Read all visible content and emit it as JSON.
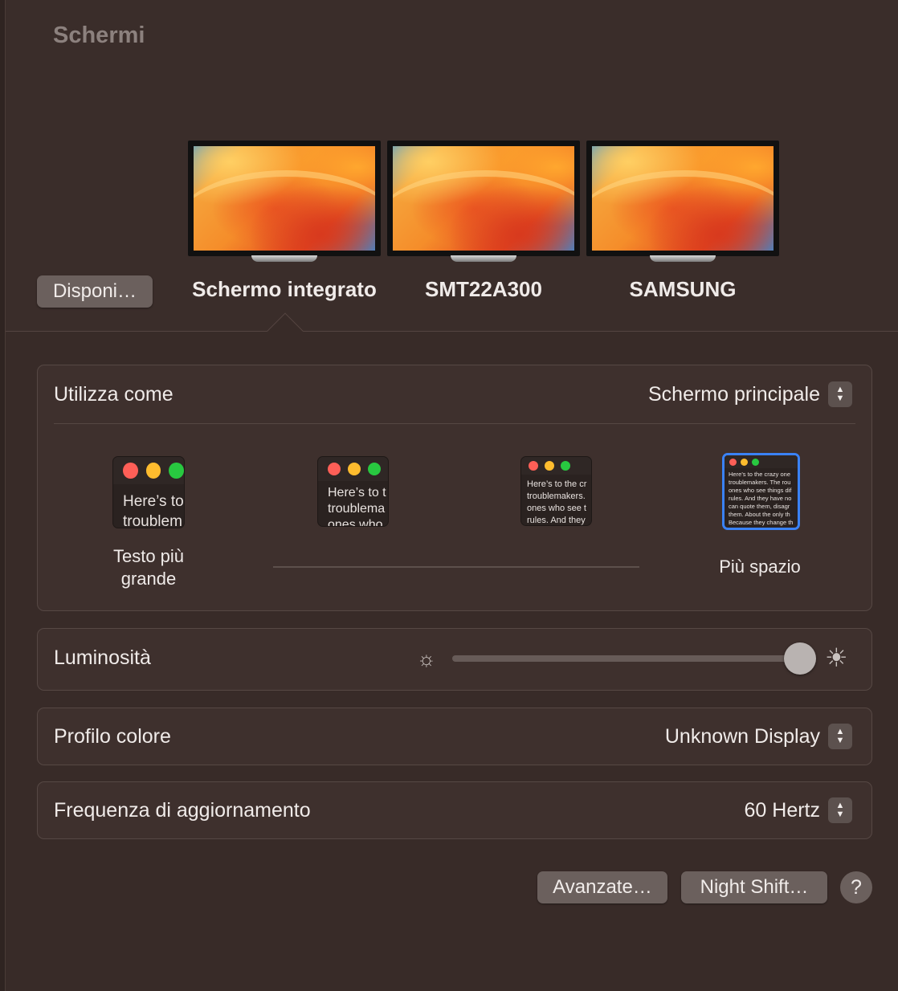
{
  "window": {
    "title": "Schermi"
  },
  "arrange_button": {
    "label": "Disponi…"
  },
  "displays": [
    {
      "label": "Schermo integrato",
      "selected": true
    },
    {
      "label": "SMT22A300",
      "selected": false
    },
    {
      "label": "SAMSUNG",
      "selected": false
    }
  ],
  "use_as": {
    "label": "Utilizza come",
    "value": "Schermo principale"
  },
  "resolution": {
    "options": [
      {
        "text_line1": "Here’s to",
        "text_line2": "troublem"
      },
      {
        "text_line1": "Here’s to t",
        "text_line2": "troublema",
        "text_line3": "ones who"
      },
      {
        "text_line1": "Here’s to the cr",
        "text_line2": "troublemakers.",
        "text_line3": "ones who see t",
        "text_line4": "rules. And they"
      },
      {
        "text_line1": "Here’s to the crazy one",
        "text_line2": "troublemakers. The rou",
        "text_line3": "ones who see things dif",
        "text_line4": "rules. And they have no",
        "text_line5": "can quote them, disagr",
        "text_line6": "them. About the only th",
        "text_line7": "Because they change th"
      }
    ],
    "left_caption": "Testo più grande",
    "left_caption_line1": "Testo più",
    "left_caption_line2": "grande",
    "right_caption": "Più spazio",
    "selected_index": 3
  },
  "brightness": {
    "label": "Luminosità",
    "level_fraction": 0.96
  },
  "color_profile": {
    "label": "Profilo colore",
    "value": "Unknown Display"
  },
  "refresh_rate": {
    "label": "Frequenza di aggiornamento",
    "value": "60 Hertz"
  },
  "buttons": {
    "advanced": "Avanzate…",
    "night_shift": "Night Shift…",
    "help": "?"
  },
  "colors": {
    "accent": "#3a82f7",
    "traffic_red": "#fe5f57",
    "traffic_yellow": "#febc2e",
    "traffic_green": "#28c840"
  }
}
